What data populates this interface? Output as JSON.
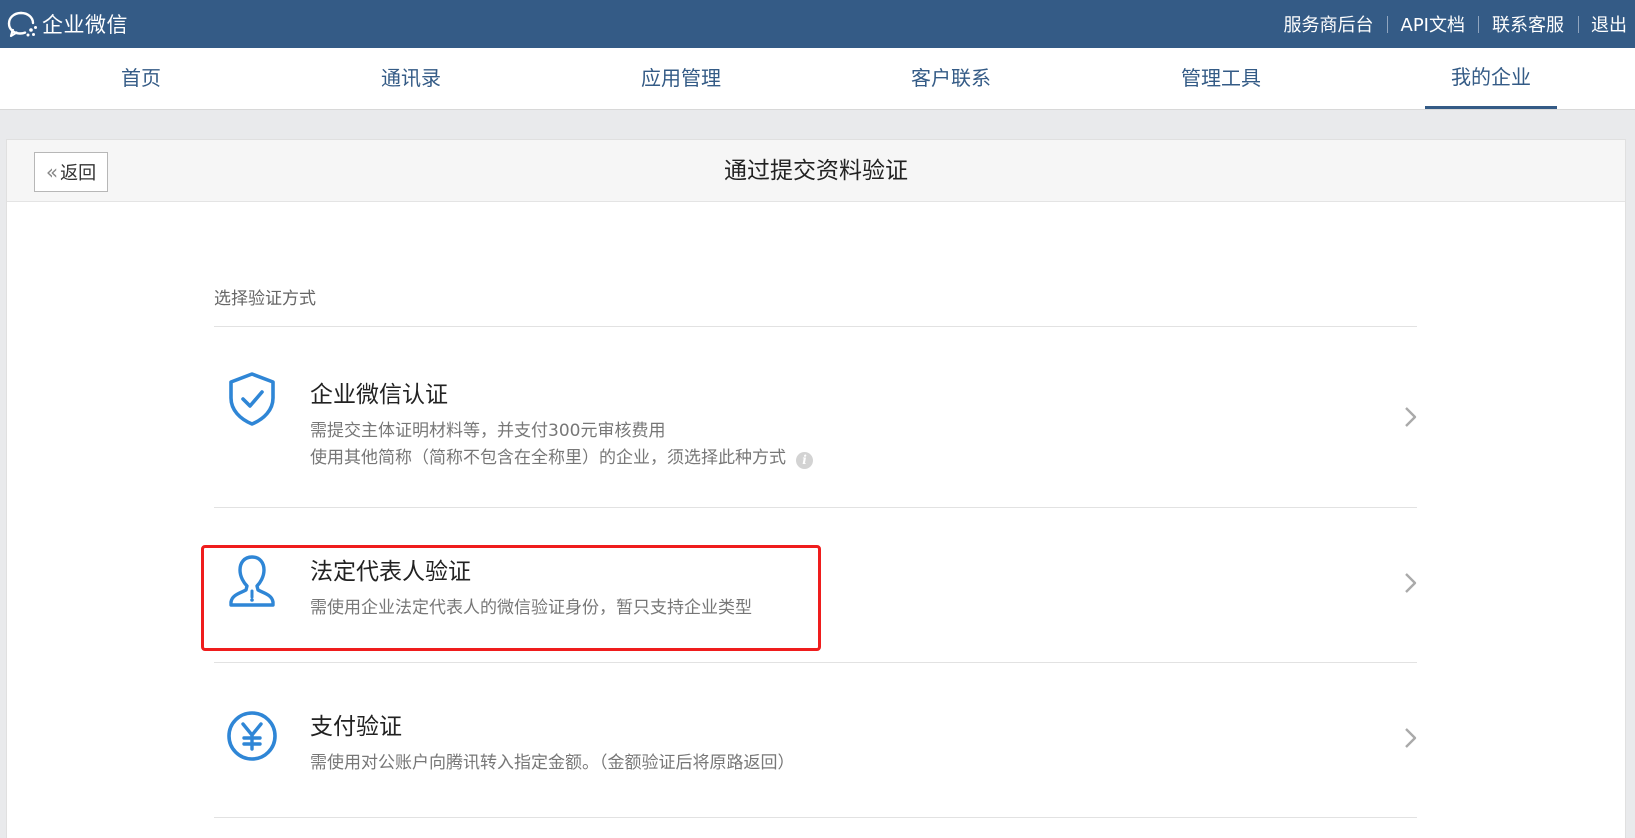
{
  "app": {
    "logo_text": "企业微信",
    "logo_icon": "wecom-chat-bubble-icon"
  },
  "top_links": {
    "service_provider": "服务商后台",
    "api_docs": "API文档",
    "contact_support": "联系客服",
    "logout": "退出"
  },
  "nav": {
    "items": [
      {
        "label": "首页"
      },
      {
        "label": "通讯录"
      },
      {
        "label": "应用管理"
      },
      {
        "label": "客户联系"
      },
      {
        "label": "管理工具"
      },
      {
        "label": "我的企业"
      }
    ],
    "active": "我的企业"
  },
  "panel": {
    "back_label": "返回",
    "title": "通过提交资料验证",
    "section_label": "选择验证方式"
  },
  "options": [
    {
      "title": "企业微信认证",
      "desc_lines": [
        "需提交主体证明材料等，并支付300元审核费用",
        "使用其他简称（简称不包含在全称里）的企业，须选择此种方式"
      ],
      "icon": "shield-check-icon",
      "has_info": true
    },
    {
      "title": "法定代表人验证",
      "desc_lines": [
        "需使用企业法定代表人的微信验证身份，暂只支持企业类型"
      ],
      "icon": "person-icon",
      "highlighted": true
    },
    {
      "title": "支付验证",
      "desc_lines": [
        "需使用对公账户向腾讯转入指定金额。（金额验证后将原路返回）"
      ],
      "icon": "yen-coin-icon"
    }
  ],
  "colors": {
    "header_bg": "#345b86",
    "nav_text": "#345b86",
    "icon_blue": "#2f86d6",
    "highlight_red": "#ef1d1d"
  }
}
